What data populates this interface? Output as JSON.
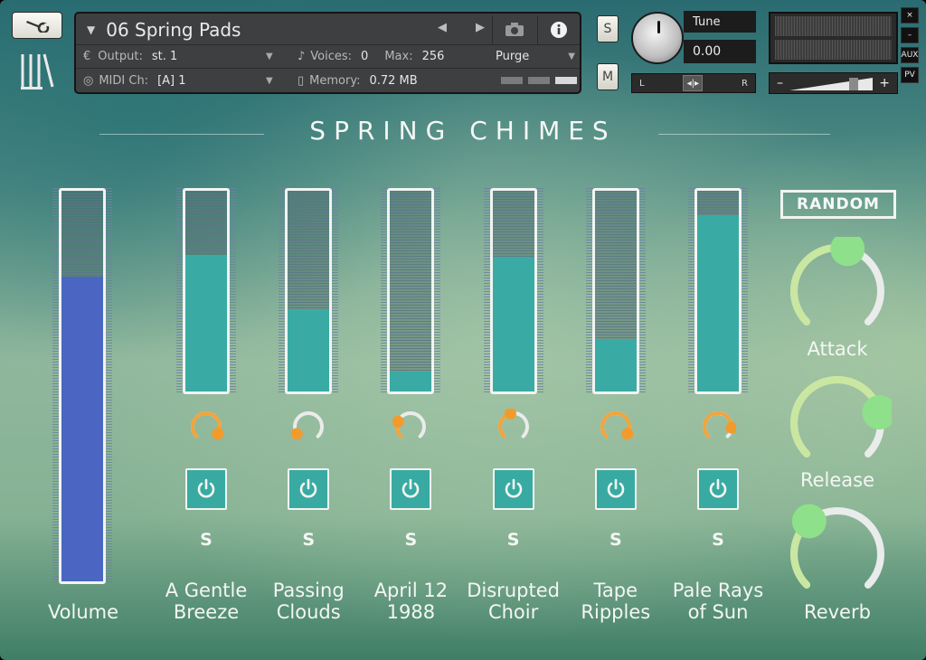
{
  "header": {
    "instrument_name": "06 Spring Pads",
    "output_label": "Output:",
    "output_value": "st. 1",
    "voices_label": "Voices:",
    "voices_value": "0",
    "max_label": "Max:",
    "max_value": "256",
    "midi_label": "MIDI Ch:",
    "midi_value": "[A]  1",
    "memory_label": "Memory:",
    "memory_value": "0.72 MB",
    "purge_label": "Purge",
    "solo_label": "S",
    "mute_label": "M",
    "tune_label": "Tune",
    "tune_value": "0.00",
    "pan_left": "L",
    "pan_right": "R",
    "vol_minus": "–",
    "vol_plus": "+",
    "side_close": "×",
    "side_min": "–",
    "side_aux": "AUX",
    "side_pv": "PV"
  },
  "title": "SPRING CHIMES",
  "volume": {
    "label": "Volume",
    "level": 0.78,
    "color": "#4b66c2"
  },
  "layers": [
    {
      "line1": "A Gentle",
      "line2": "Breeze",
      "level": 0.68,
      "knob": 0.95,
      "solo": "S"
    },
    {
      "line1": "Passing",
      "line2": "Clouds",
      "level": 0.41,
      "knob": 0.05,
      "solo": "S"
    },
    {
      "line1": "April 12",
      "line2": "1988",
      "level": 0.1,
      "knob": 0.25,
      "solo": "S"
    },
    {
      "line1": "Disrupted",
      "line2": "Choir",
      "level": 0.67,
      "knob": 0.45,
      "solo": "S"
    },
    {
      "line1": "Tape",
      "line2": "Ripples",
      "level": 0.26,
      "knob": 0.95,
      "solo": "S"
    },
    {
      "line1": "Pale Rays",
      "line2": "of Sun",
      "level": 0.88,
      "knob": 0.85,
      "solo": "S"
    }
  ],
  "layer_fill_color": "#3aaba4",
  "random_label": "RANDOM",
  "macros": [
    {
      "label": "Attack",
      "value": 0.55
    },
    {
      "label": "Release",
      "value": 0.78
    },
    {
      "label": "Reverb",
      "value": 0.35
    }
  ],
  "colors": {
    "knob_track": "#e9ecea",
    "knob_arc": "#c9e7a0",
    "knob_handle": "#8fe08a",
    "small_knob_arc": "#f2a43c",
    "small_knob_handle": "#f39a2c"
  }
}
